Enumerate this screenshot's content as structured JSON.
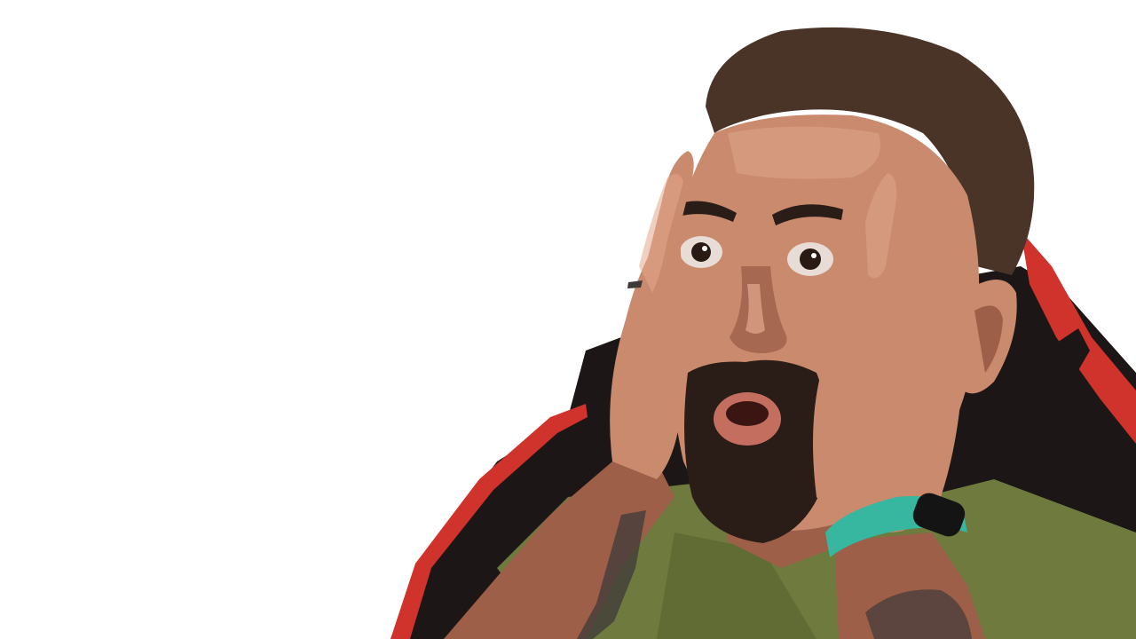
{
  "image": {
    "background_color": "#ffffff",
    "subject": "surprised-man-cutout",
    "colors": {
      "skin": "#c98a6e",
      "skin_shadow": "#9e5f48",
      "skin_highlight": "#e2a88c",
      "hair": "#4a3428",
      "beard": "#2a1c16",
      "shirt": "#6f7a3e",
      "shirt_shadow": "#56602c",
      "chair_black": "#1c1616",
      "chair_red": "#d0322c",
      "watch_band": "#37b7a0",
      "watch_face": "#141414",
      "eye_white": "#e8ddd6",
      "iris": "#2a1a14",
      "mouth": "#3a1512",
      "lips": "#c46e60",
      "tattoo": "#3e3a3a"
    },
    "icons": [
      "gaming-chair",
      "wristwatch"
    ]
  }
}
